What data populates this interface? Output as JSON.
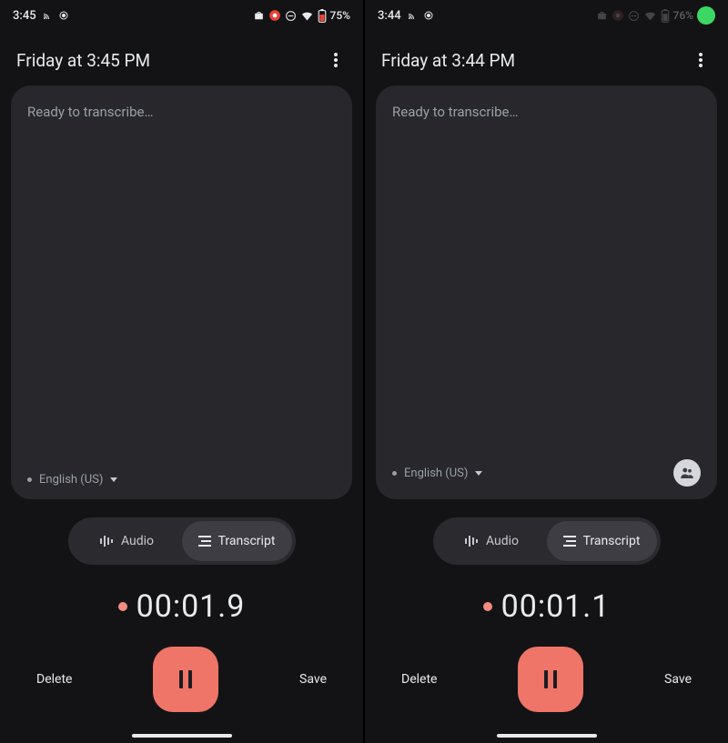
{
  "screens": [
    {
      "status": {
        "time": "3:45",
        "battery": "75%",
        "dim": false,
        "show_green_pill": false
      },
      "title": "Friday at 3:45 PM",
      "placeholder": "Ready to transcribe…",
      "language": "English (US)",
      "show_people_button": false,
      "tabs": {
        "audio": "Audio",
        "transcript": "Transcript",
        "active": "transcript"
      },
      "timer": "00:01.9",
      "delete_label": "Delete",
      "save_label": "Save"
    },
    {
      "status": {
        "time": "3:44",
        "battery": "76%",
        "dim": true,
        "show_green_pill": true
      },
      "title": "Friday at 3:44 PM",
      "placeholder": "Ready to transcribe…",
      "language": "English (US)",
      "show_people_button": true,
      "tabs": {
        "audio": "Audio",
        "transcript": "Transcript",
        "active": "transcript"
      },
      "timer": "00:01.1",
      "delete_label": "Delete",
      "save_label": "Save"
    }
  ]
}
